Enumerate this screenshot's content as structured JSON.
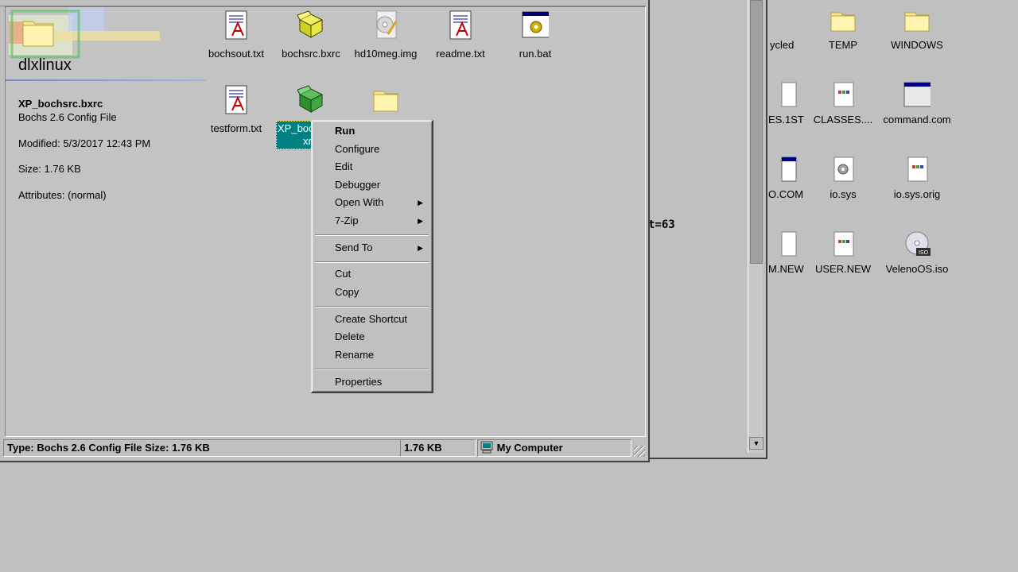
{
  "back_window": {
    "terminal_fragment": "t=63",
    "icons": [
      {
        "label": "ycled",
        "icon": "recycle-bin-icon"
      },
      {
        "label": "TEMP",
        "icon": "folder-icon"
      },
      {
        "label": "WINDOWS",
        "icon": "folder-icon"
      },
      {
        "label": "ES.1ST",
        "icon": "text-file-icon"
      },
      {
        "label": "CLASSES....",
        "icon": "text-file-icon"
      },
      {
        "label": "command.com",
        "icon": "dos-app-icon"
      },
      {
        "label": "O.COM",
        "icon": "dos-app-icon"
      },
      {
        "label": "io.sys",
        "icon": "system-file-icon"
      },
      {
        "label": "io.sys.orig",
        "icon": "text-file-icon"
      },
      {
        "label": "M.NEW",
        "icon": "text-file-icon"
      },
      {
        "label": "USER.NEW",
        "icon": "text-file-icon"
      },
      {
        "label": "VelenoOS.iso",
        "icon": "iso-disc-icon"
      }
    ]
  },
  "explorer": {
    "folder_title": "dlxlinux",
    "selected_file": {
      "name": "XP_bochsrc.bxrc",
      "type": "Bochs 2.6 Config File",
      "modified": "Modified: 5/3/2017 12:43 PM",
      "size": "Size: 1.76 KB",
      "attributes": "Attributes: (normal)"
    },
    "files": [
      {
        "label": "bochsout.txt",
        "icon": "text-document-icon"
      },
      {
        "label": "bochsrc.bxrc",
        "icon": "bochs-config-icon"
      },
      {
        "label": "hd10meg.img",
        "icon": "disk-image-icon"
      },
      {
        "label": "readme.txt",
        "icon": "text-document-icon"
      },
      {
        "label": "run.bat",
        "icon": "batch-file-icon"
      },
      {
        "label": "testform.txt",
        "icon": "text-document-icon"
      },
      {
        "label": "XP_boc",
        "label2": "xr",
        "icon": "bochs-config-icon"
      },
      {
        "label": "",
        "icon": "folder-icon"
      }
    ],
    "status": {
      "type_text": "Type: Bochs 2.6 Config File Size: 1.76 KB",
      "size_text": "1.76 KB",
      "location_text": "My Computer"
    }
  },
  "context_menu": {
    "items": [
      {
        "label": "Run",
        "default": true
      },
      {
        "label": "Configure"
      },
      {
        "label": "Edit"
      },
      {
        "label": "Debugger"
      },
      {
        "label": "Open With",
        "submenu": true
      },
      {
        "label": "7-Zip",
        "submenu": true
      },
      {
        "label": "Send To",
        "submenu": true
      },
      {
        "label": "Cut"
      },
      {
        "label": "Copy"
      },
      {
        "label": "Create Shortcut"
      },
      {
        "label": "Delete"
      },
      {
        "label": "Rename"
      },
      {
        "label": "Properties"
      }
    ],
    "submenu_arrow": "▶"
  },
  "colors": {
    "selection": "#008080",
    "face": "#c0c0c0"
  }
}
